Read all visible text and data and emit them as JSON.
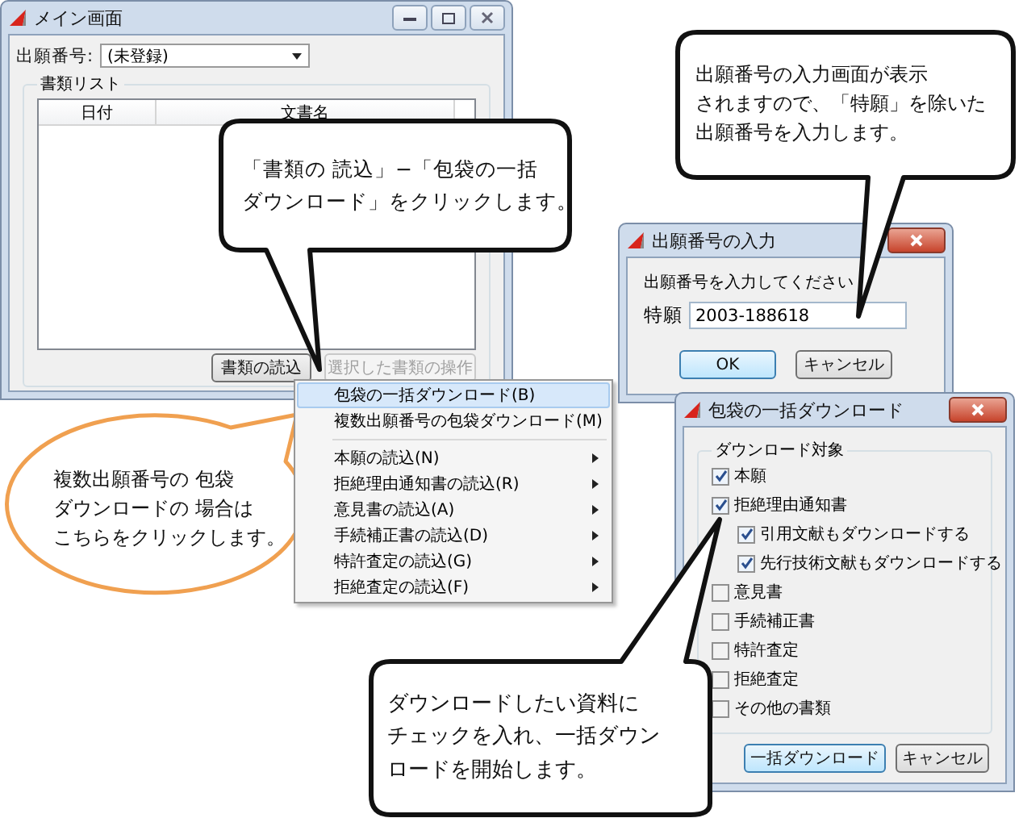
{
  "main_window": {
    "title": "メイン画面",
    "number_label": "出願番号:",
    "number_value": "(未登録)",
    "group_label": "書類リスト",
    "table": {
      "columns": [
        "日付",
        "文書名"
      ]
    },
    "buttons": [
      {
        "label": "書類の読込",
        "disabled": false
      },
      {
        "label": "選択した書類の操作",
        "disabled": true
      }
    ]
  },
  "context_menu": {
    "groups": [
      [
        {
          "label": "包袋の一括ダウンロード(B)",
          "selected": true,
          "submenu": false
        },
        {
          "label": "複数出願番号の包袋ダウンロード(M)",
          "selected": false,
          "submenu": false
        }
      ],
      [
        {
          "label": "本願の読込(N)",
          "selected": false,
          "submenu": true
        },
        {
          "label": "拒絶理由通知書の読込(R)",
          "selected": false,
          "submenu": true
        },
        {
          "label": "意見書の読込(A)",
          "selected": false,
          "submenu": true
        },
        {
          "label": "手続補正書の読込(D)",
          "selected": false,
          "submenu": true
        },
        {
          "label": "特許査定の読込(G)",
          "selected": false,
          "submenu": true
        },
        {
          "label": "拒絶査定の読込(F)",
          "selected": false,
          "submenu": true
        }
      ]
    ]
  },
  "input_dialog": {
    "title": "出願番号の入力",
    "prompt": "出願番号を入力してください",
    "field_label": "特願",
    "field_value": "2003-188618",
    "buttons": [
      "OK",
      "キャンセル"
    ]
  },
  "download_dialog": {
    "title": "包袋の一括ダウンロード",
    "group_label": "ダウンロード対象",
    "items": [
      {
        "label": "本願",
        "checked": true
      },
      {
        "label": "拒絶理由通知書",
        "checked": true,
        "children": [
          {
            "label": "引用文献もダウンロードする",
            "checked": true
          },
          {
            "label": "先行技術文献もダウンロードする",
            "checked": true
          }
        ]
      },
      {
        "label": "意見書",
        "checked": false
      },
      {
        "label": "手続補正書",
        "checked": false
      },
      {
        "label": "特許査定",
        "checked": false
      },
      {
        "label": "拒絶査定",
        "checked": false
      },
      {
        "label": "その他の書類",
        "checked": false
      }
    ],
    "buttons": [
      "一括ダウンロード",
      "キャンセル"
    ]
  },
  "callouts": [
    {
      "kind": "rounded",
      "lines": [
        "出願番号の入力画面が表示",
        "されますので、「特願」を除いた",
        "出願番号を入力します。"
      ]
    },
    {
      "kind": "rounded",
      "lines": [
        "「書類の 読込」−「包袋の一括",
        "ダウンロード」をクリックします。"
      ]
    },
    {
      "kind": "oval",
      "lines": [
        "複数出願番号の 包袋",
        "ダウンロードの 場合は",
        "こちらをクリックします。"
      ]
    },
    {
      "kind": "rounded",
      "lines": [
        "ダウンロードしたい資料に",
        "チェックを入れ、一括ダウン",
        "ロードを開始します。"
      ]
    }
  ]
}
